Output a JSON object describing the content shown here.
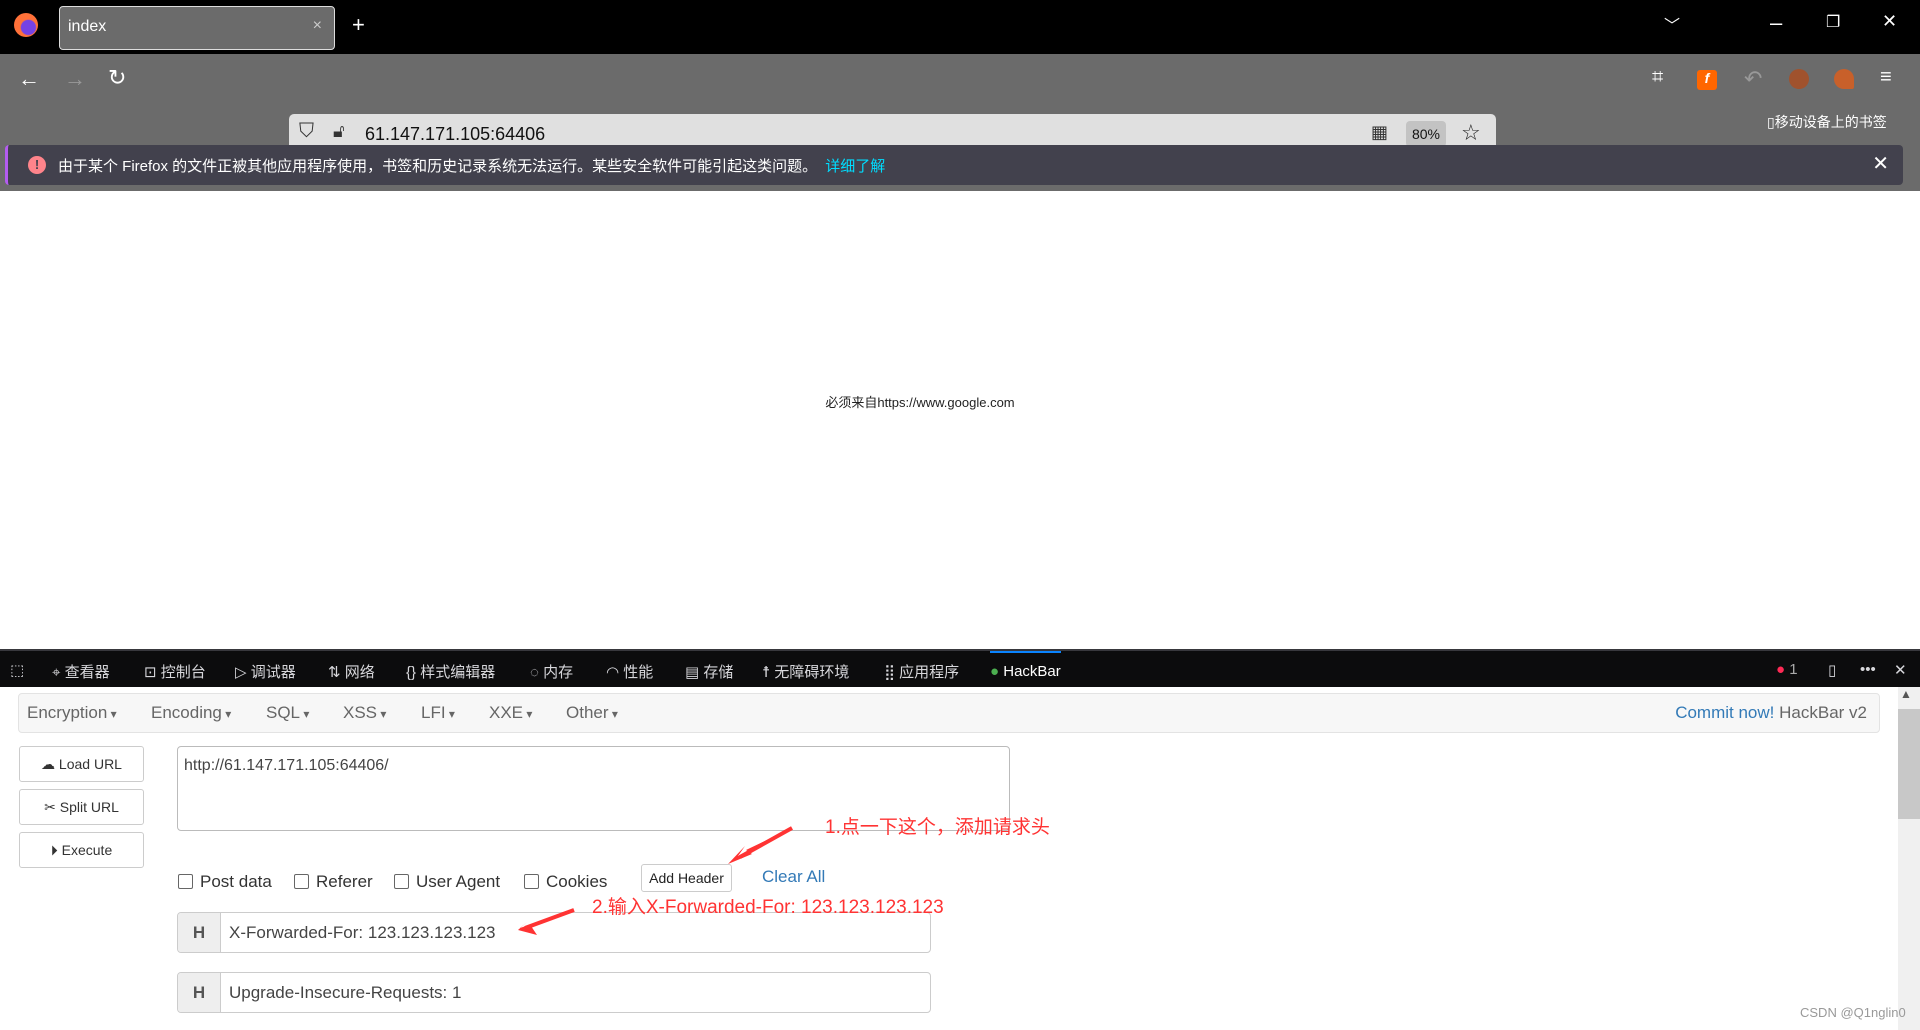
{
  "browser": {
    "tab_title": "index",
    "tab_close": "×",
    "new_tab": "+",
    "url": "61.147.171.105:64406",
    "zoom": "80%",
    "mobile_bookmarks": "移动设备上的书签",
    "notification": {
      "text": "由于某个 Firefox 的文件正被其他应用程序使用，书签和历史记录系统无法运行。某些安全软件可能引起这类问题。",
      "link": "详细了解"
    }
  },
  "page": {
    "message": "必须来自https://www.google.com"
  },
  "devtools": {
    "tabs": [
      "查看器",
      "控制台",
      "调试器",
      "网络",
      "样式编辑器",
      "内存",
      "性能",
      "存储",
      "无障碍环境",
      "应用程序",
      "HackBar"
    ],
    "error_count": "1"
  },
  "hackbar": {
    "menus": [
      "Encryption",
      "Encoding",
      "SQL",
      "XSS",
      "LFI",
      "XXE",
      "Other"
    ],
    "commit": "Commit now!",
    "version": "HackBar v2",
    "buttons": {
      "load": "Load URL",
      "split": "Split URL",
      "execute": "Execute"
    },
    "url_value": "http://61.147.171.105:64406/",
    "checkboxes": [
      "Post data",
      "Referer",
      "User Agent",
      "Cookies"
    ],
    "add_header": "Add Header",
    "clear_all": "Clear All",
    "headers": [
      {
        "label": "H",
        "value": "X-Forwarded-For: 123.123.123.123"
      },
      {
        "label": "H",
        "value": "Upgrade-Insecure-Requests: 1"
      }
    ]
  },
  "annotations": {
    "step1": "1.点一下这个，添加请求头",
    "step2": "2.输入X-Forwarded-For: 123.123.123.123"
  },
  "watermark": "CSDN @Q1nglin0",
  "colors": {
    "annotation": "#ff3333",
    "link": "#337ab7",
    "notice_bg": "#42414d"
  }
}
